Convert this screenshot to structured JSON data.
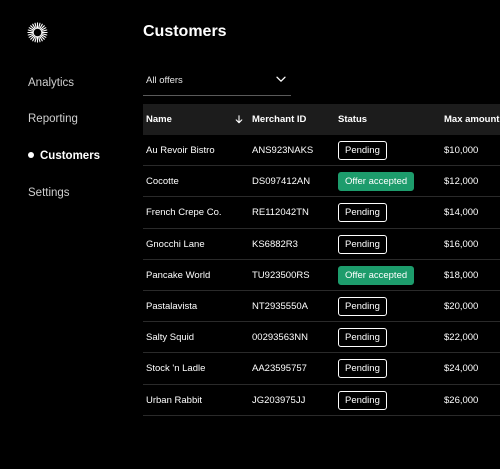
{
  "app": {
    "logo_icon": "sunburst-logo-icon"
  },
  "nav": {
    "items": [
      {
        "label": "Analytics",
        "active": false
      },
      {
        "label": "Reporting",
        "active": false
      },
      {
        "label": "Customers",
        "active": true
      },
      {
        "label": "Settings",
        "active": false
      }
    ]
  },
  "page": {
    "title": "Customers"
  },
  "filter": {
    "selected": "All offers",
    "icon": "chevron-down-icon"
  },
  "table": {
    "columns": {
      "name": "Name",
      "merchant_id": "Merchant ID",
      "status": "Status",
      "max_amount": "Max amount"
    },
    "sort_icon": "sort-down-arrow-icon",
    "rows": [
      {
        "name": "Au Revoir Bistro",
        "merchant_id": "ANS923NAKS",
        "status": "Pending",
        "max_amount": "$10,000"
      },
      {
        "name": "Cocotte",
        "merchant_id": "DS097412AN",
        "status": "Offer accepted",
        "max_amount": "$12,000"
      },
      {
        "name": "French Crepe Co.",
        "merchant_id": "RE112042TN",
        "status": "Pending",
        "max_amount": "$14,000"
      },
      {
        "name": "Gnocchi Lane",
        "merchant_id": "KS6882R3",
        "status": "Pending",
        "max_amount": "$16,000"
      },
      {
        "name": "Pancake World",
        "merchant_id": "TU923500RS",
        "status": "Offer accepted",
        "max_amount": "$18,000"
      },
      {
        "name": "Pastalavista",
        "merchant_id": "NT2935550A",
        "status": "Pending",
        "max_amount": "$20,000"
      },
      {
        "name": "Salty Squid",
        "merchant_id": "00293563NN",
        "status": "Pending",
        "max_amount": "$22,000"
      },
      {
        "name": "Stock 'n Ladle",
        "merchant_id": "AA23595757",
        "status": "Pending",
        "max_amount": "$24,000"
      },
      {
        "name": "Urban Rabbit",
        "merchant_id": "JG203975JJ",
        "status": "Pending",
        "max_amount": "$26,000"
      }
    ]
  },
  "colors": {
    "accent_green": "#1d9c6c",
    "background": "#000000",
    "header_bg": "#1c1c1c"
  }
}
